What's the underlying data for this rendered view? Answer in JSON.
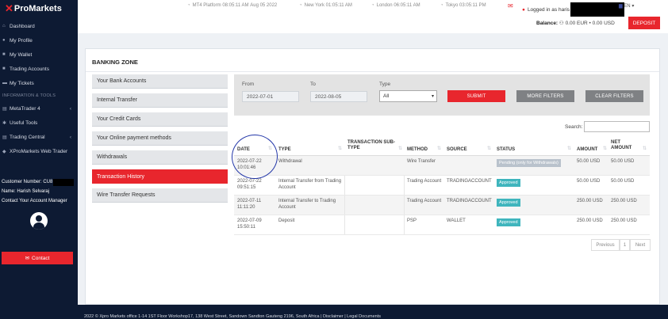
{
  "brand": {
    "logo_text": "ProMarkets",
    "accent": "#e8262d",
    "sidebar_bg": "#0d1a33"
  },
  "sidebar": {
    "items": [
      {
        "label": "Dashboard",
        "icon": "home-icon"
      },
      {
        "label": "My Profile",
        "icon": "user-icon"
      },
      {
        "label": "My Wallet",
        "icon": "folder-icon"
      },
      {
        "label": "Trading Accounts",
        "icon": "folder-icon"
      },
      {
        "label": "My Tickets",
        "icon": "ticket-icon"
      }
    ],
    "section_label": "INFORMATION & TOOLS",
    "tools": [
      {
        "label": "MetaTrader 4",
        "icon": "chart-icon"
      },
      {
        "label": "Useful Tools",
        "icon": "gear-icon"
      },
      {
        "label": "Trading Central",
        "icon": "chart-icon"
      },
      {
        "label": "XProMarkets Web Trader",
        "icon": "layers-icon"
      }
    ],
    "customer_number_label": "Customer Number: CU8",
    "name_label": "Name: Harish Selvaraj",
    "contact_manager_label": "Contact Your Account Manager",
    "contact_button": "Contact"
  },
  "topbar": {
    "clocks": [
      {
        "label": "MT4 Platform",
        "time": "08:05:11 AM",
        "date": "Aug 05 2022"
      },
      {
        "label": "New York",
        "time": "01:05:11 AM"
      },
      {
        "label": "London",
        "time": "06:05:11 AM"
      },
      {
        "label": "Tokyo",
        "time": "03:05:11 PM"
      }
    ],
    "logged_in_label": "Logged in as haris",
    "language": "EN",
    "balance_label": "Balance:",
    "balance_value": "0.00 EUR • 0.00 USD",
    "deposit_button": "DEPOSIT"
  },
  "banking": {
    "title": "BANKING ZONE",
    "menu": [
      "Your Bank Accounts",
      "Internal Transfer",
      "Your Credit Cards",
      "Your Online payment methods",
      "Withdrawals",
      "Transaction History",
      "Wire Transfer Requests"
    ],
    "active_index": 5
  },
  "filters": {
    "from_label": "From",
    "from_value": "2022-07-01",
    "to_label": "To",
    "to_value": "2022-08-05",
    "type_label": "Type",
    "type_value": "All",
    "submit": "SUBMIT",
    "more": "MORE FILTERS",
    "clear": "CLEAR FILTERS"
  },
  "search": {
    "label": "Search:"
  },
  "table": {
    "headers": {
      "date": "DATE",
      "type": "TYPE",
      "subtype": "TRANSACTION SUB-TYPE",
      "method": "METHOD",
      "source": "SOURCE",
      "status": "STATUS",
      "amount": "AMOUNT",
      "net": "NET AMOUNT"
    },
    "rows": [
      {
        "date": "2022-07-22 10:01:46",
        "type": "Withdrawal",
        "subtype": "",
        "method": "Wire Transfer",
        "source": "",
        "status": "Pending (only for Withdrawals)",
        "status_kind": "pending",
        "amount": "50.00 USD",
        "net": "50.00 USD"
      },
      {
        "date": "2022-07-22 09:51:15",
        "type": "Internal Transfer from Trading Account",
        "subtype": "",
        "method": "Trading Account",
        "source": "TRADINGACCOUNT",
        "status": "Approved",
        "status_kind": "approved",
        "amount": "50.00 USD",
        "net": "50.00 USD"
      },
      {
        "date": "2022-07-11 11:11:20",
        "type": "Internal Transfer to Trading Account",
        "subtype": "",
        "method": "Trading Account",
        "source": "TRADINGACCOUNT",
        "status": "Approved",
        "status_kind": "approved",
        "amount": "250.00 USD",
        "net": "250.00 USD"
      },
      {
        "date": "2022-07-09 15:50:11",
        "type": "Deposit",
        "subtype": "",
        "method": "PSP",
        "source": "WALLET",
        "status": "Approved",
        "status_kind": "approved",
        "amount": "250.00 USD",
        "net": "250.00 USD"
      }
    ]
  },
  "pagination": {
    "previous": "Previous",
    "page": "1",
    "next": "Next"
  },
  "footer": {
    "text": "2022 © Xpro Markets office 1-14 1ST Floor Workshop17, 138 West Street, Sandown Sandton Gauteng 2196, South Africa | Disclaimer | Legal Documents"
  }
}
